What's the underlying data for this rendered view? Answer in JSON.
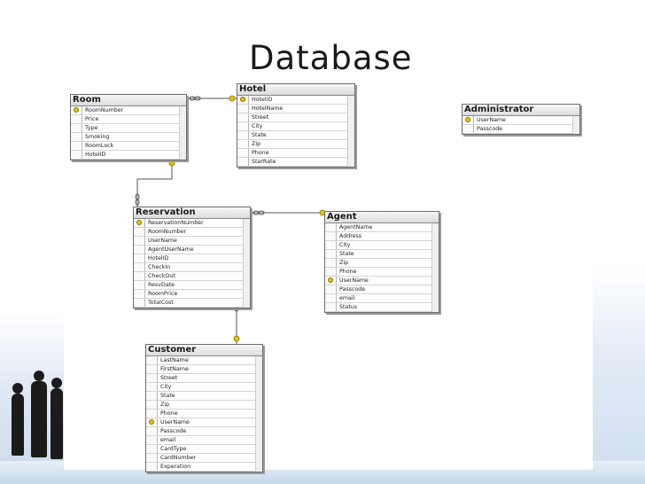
{
  "slide": {
    "title": "Database"
  },
  "tables": {
    "room": {
      "name": "Room",
      "columns": [
        {
          "name": "RoomNumber",
          "key": true
        },
        {
          "name": "Price",
          "key": false
        },
        {
          "name": "Type",
          "key": false
        },
        {
          "name": "Smoking",
          "key": false
        },
        {
          "name": "RoomLock",
          "key": false
        },
        {
          "name": "HotelID",
          "key": false
        }
      ]
    },
    "hotel": {
      "name": "Hotel",
      "columns": [
        {
          "name": "HotelID",
          "key": true
        },
        {
          "name": "HotelName",
          "key": false
        },
        {
          "name": "Street",
          "key": false
        },
        {
          "name": "City",
          "key": false
        },
        {
          "name": "State",
          "key": false
        },
        {
          "name": "Zip",
          "key": false
        },
        {
          "name": "Phone",
          "key": false
        },
        {
          "name": "StarRate",
          "key": false
        }
      ]
    },
    "administrator": {
      "name": "Administrator",
      "columns": [
        {
          "name": "UserName",
          "key": true
        },
        {
          "name": "Passcode",
          "key": false
        }
      ]
    },
    "reservation": {
      "name": "Reservation",
      "columns": [
        {
          "name": "ReservationNumber",
          "key": true
        },
        {
          "name": "RoomNumber",
          "key": false
        },
        {
          "name": "UserName",
          "key": false
        },
        {
          "name": "AgentUserName",
          "key": false
        },
        {
          "name": "HotelID",
          "key": false
        },
        {
          "name": "CheckIn",
          "key": false
        },
        {
          "name": "CheckOut",
          "key": false
        },
        {
          "name": "ResvDate",
          "key": false
        },
        {
          "name": "RoomPrice",
          "key": false
        },
        {
          "name": "TotalCost",
          "key": false
        }
      ]
    },
    "agent": {
      "name": "Agent",
      "columns": [
        {
          "name": "AgentName",
          "key": false
        },
        {
          "name": "Address",
          "key": false
        },
        {
          "name": "City",
          "key": false
        },
        {
          "name": "State",
          "key": false
        },
        {
          "name": "Zip",
          "key": false
        },
        {
          "name": "Phone",
          "key": false
        },
        {
          "name": "UserName",
          "key": true
        },
        {
          "name": "Passcode",
          "key": false
        },
        {
          "name": "email",
          "key": false
        },
        {
          "name": "Status",
          "key": false
        }
      ]
    },
    "customer": {
      "name": "Customer",
      "columns": [
        {
          "name": "LastName",
          "key": false
        },
        {
          "name": "FirstName",
          "key": false
        },
        {
          "name": "Street",
          "key": false
        },
        {
          "name": "City",
          "key": false
        },
        {
          "name": "State",
          "key": false
        },
        {
          "name": "Zip",
          "key": false
        },
        {
          "name": "Phone",
          "key": false
        },
        {
          "name": "UserName",
          "key": true
        },
        {
          "name": "Passcode",
          "key": false
        },
        {
          "name": "email",
          "key": false
        },
        {
          "name": "CardType",
          "key": false
        },
        {
          "name": "CardNumber",
          "key": false
        },
        {
          "name": "Experation",
          "key": false
        }
      ]
    }
  },
  "colors": {
    "key_icon": "#e8c400",
    "table_border": "#6d6d6d",
    "relationship_line": "#555555"
  }
}
